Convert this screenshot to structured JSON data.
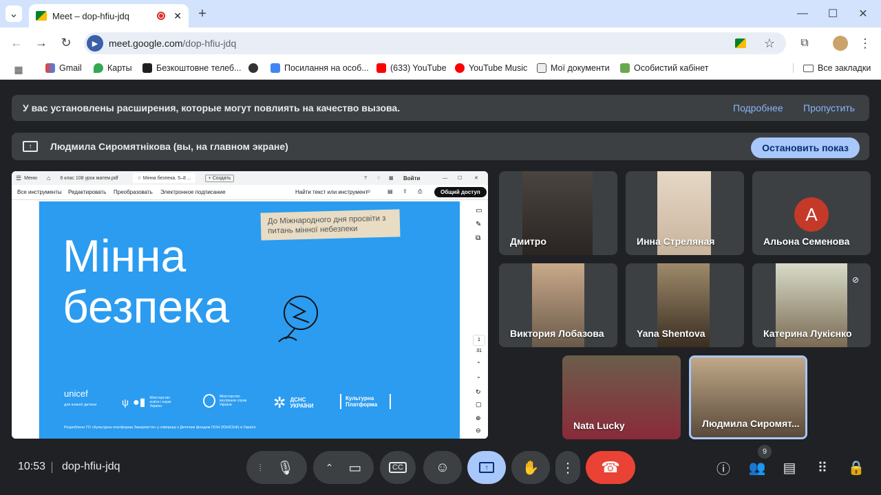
{
  "browser": {
    "tab_title": "Meet – dop-hfiu-jdq",
    "url_host": "meet.google.com",
    "url_path": "/dop-hfiu-jdq",
    "bookmarks": [
      "Gmail",
      "Карты",
      "Безкоштовне телеб...",
      "",
      "Посилання на особ...",
      "(633) YouTube",
      "YouTube Music",
      "Мої документи",
      "Особистий кабінет"
    ],
    "all_bookmarks": "Все закладки"
  },
  "meet": {
    "extension_banner": "У вас установлены расширения, которые могут повлиять на качество вызова.",
    "more_link": "Подробнее",
    "skip_link": "Пропустить",
    "presenting_text": "Людмила Сиромятнікова (вы, на главном экране)",
    "stop_button": "Остановить показ",
    "time": "10:53",
    "meeting_code": "dop-hfiu-jdq",
    "participants_count": "9"
  },
  "presentation": {
    "menu": "Меню",
    "tab1": "6 клас 108 урок матем.pdf",
    "tab2": "Мінна безпека. 5–8 ...",
    "new_tab": "+ Создать",
    "login": "Войти",
    "tools": [
      "Все инструменты",
      "Редактировать",
      "Преобразовать",
      "Электронное подписание"
    ],
    "search": "Найти текст или инструмент",
    "share": "Общий доступ",
    "title_line1": "Мінна",
    "title_line2": "безпека",
    "note": "До Міжнародного дня просвіти з питань мінної небезпеки",
    "footer": "Розроблено ГО «Культурна платформа Закарпаття» у співпраці з Дитячим фондом ООН (ЮНІСЕФ) в Україні.",
    "logo_unicef": "unicef",
    "logo_unicef_sub": "для кожної дитини",
    "logo_mon": "Міністерство освіти і науки України",
    "logo_mvs": "Міністерство внутрішніх справ України",
    "logo_dsns": "ДСНС УКРАЇНИ",
    "logo_kp": "Культурна Платформа",
    "page_num": "1",
    "page_total": "31"
  },
  "participants": [
    {
      "name": "Дмитро"
    },
    {
      "name": "Инна Стреляная"
    },
    {
      "name": "Альона Семенова",
      "initial": "A"
    },
    {
      "name": "Виктория Лобазова"
    },
    {
      "name": "Yana Shentova"
    },
    {
      "name": "Катерина Лукієнко"
    },
    {
      "name": "Nata Lucky"
    },
    {
      "name": "Людмила Сиромят..."
    }
  ],
  "colors": {
    "accent": "#a8c7fa",
    "end_call": "#ea4335",
    "slide_blue": "#2b9cf0"
  }
}
